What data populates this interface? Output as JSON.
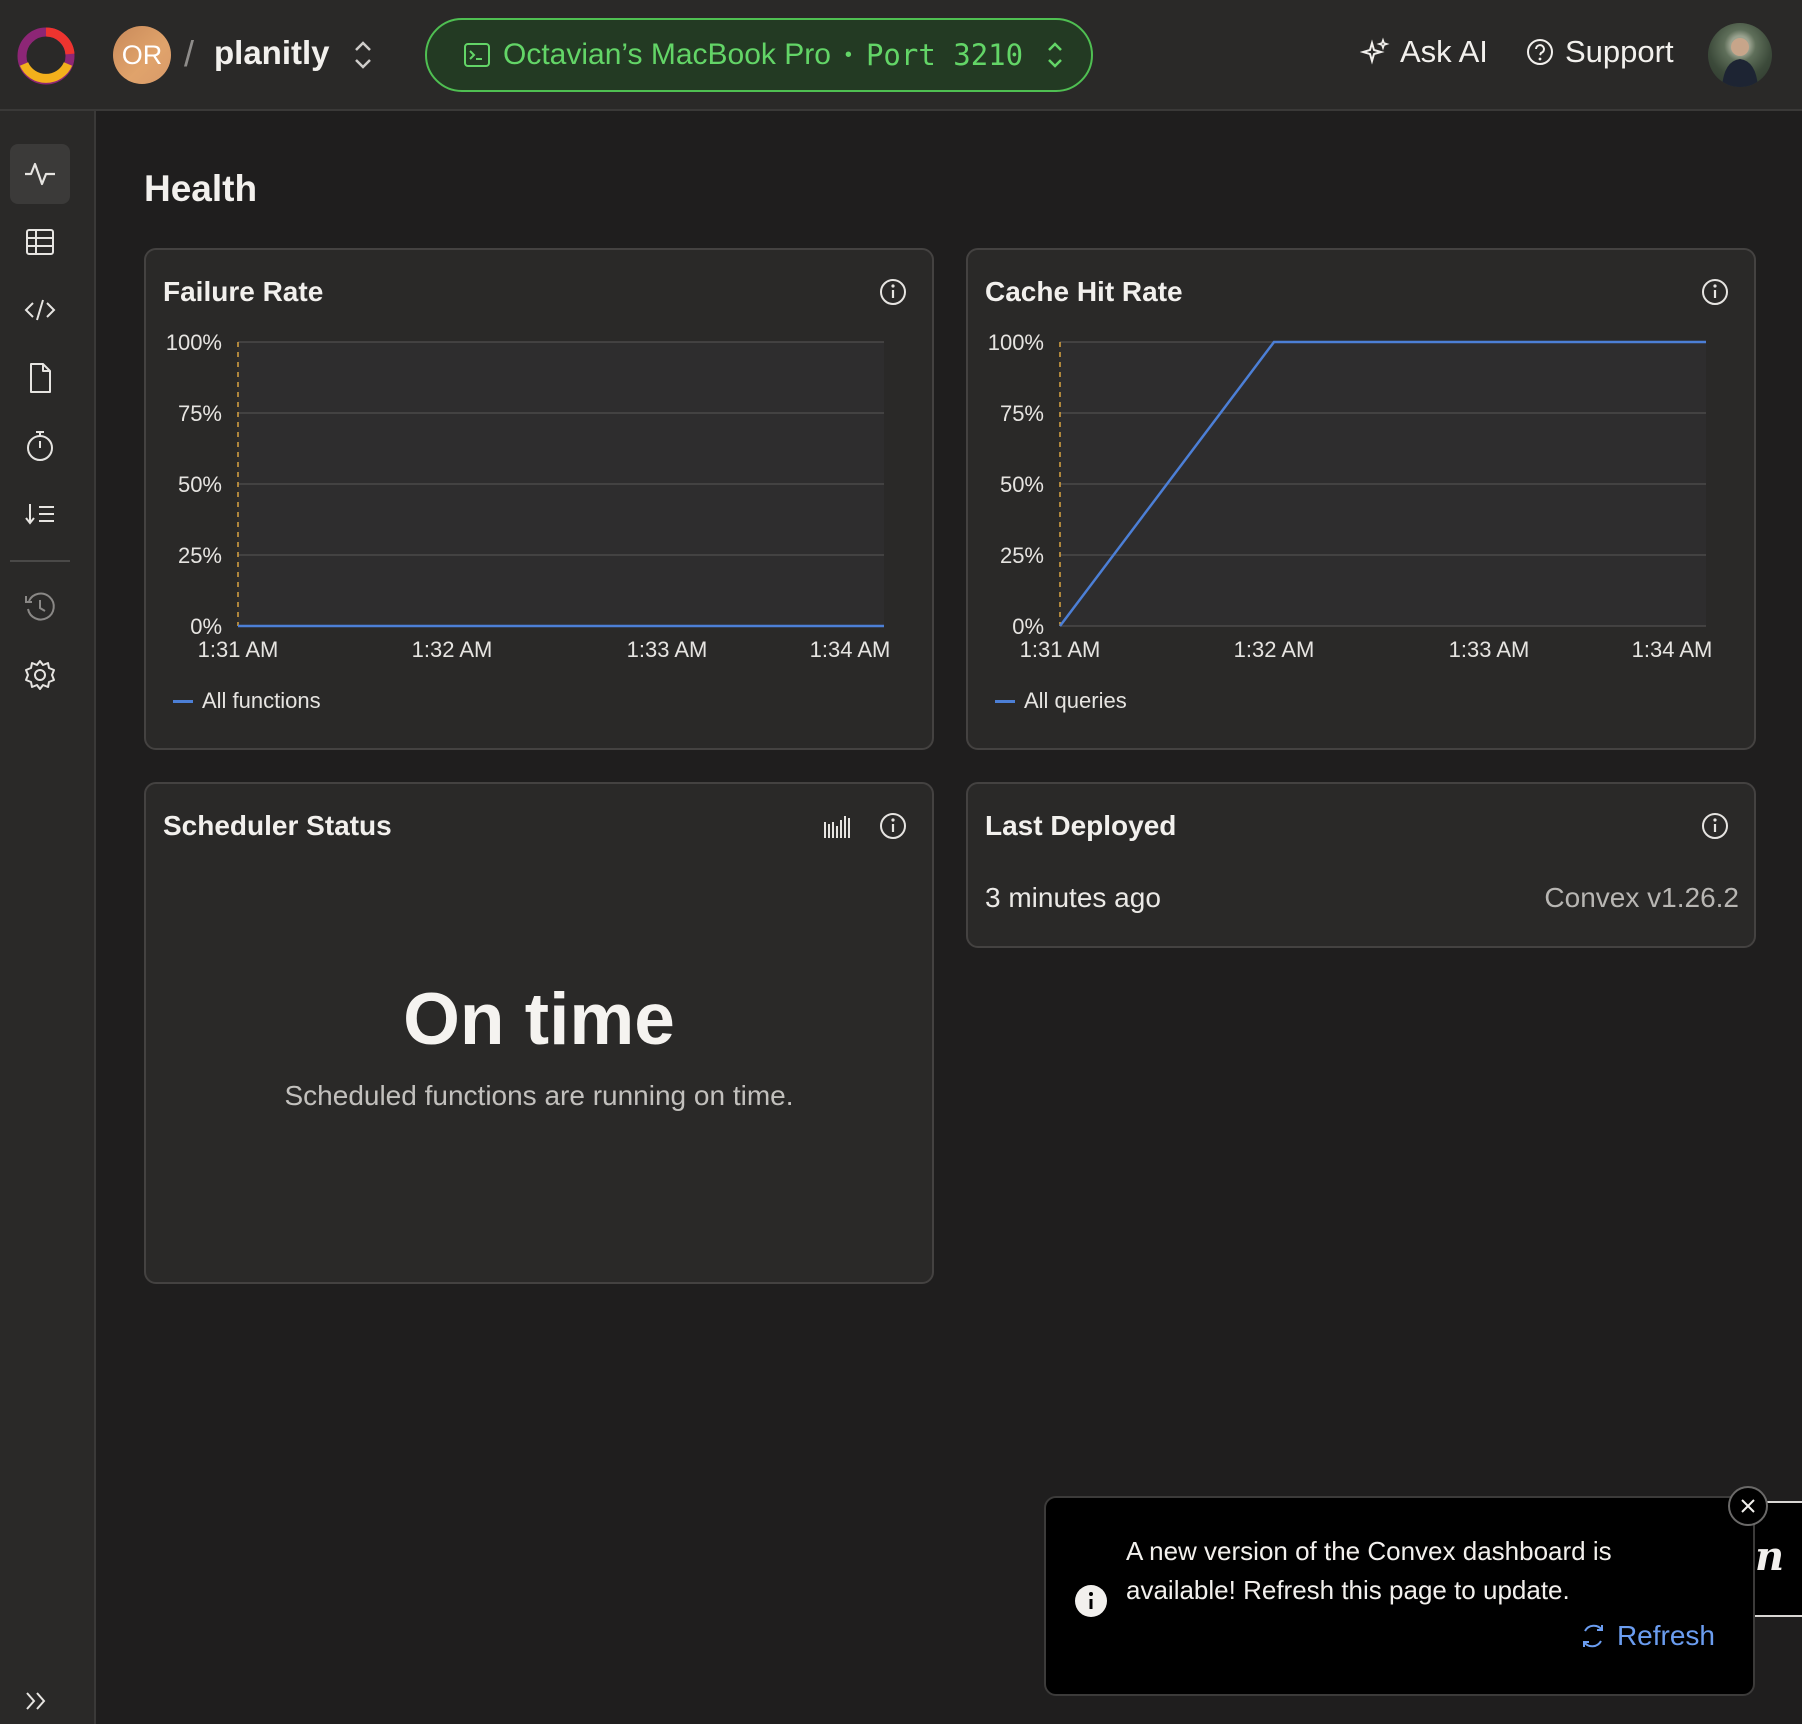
{
  "header": {
    "org_initials": "OR",
    "separator": "/",
    "project_name": "planitly",
    "deployment_name": "Octavian’s MacBook Pro",
    "deployment_dot": "•",
    "deployment_port": "Port 3210",
    "ask_ai_label": "Ask AI",
    "support_label": "Support"
  },
  "sidebar": {
    "items": [
      {
        "name": "health",
        "icon": "activity-icon"
      },
      {
        "name": "data",
        "icon": "table-icon"
      },
      {
        "name": "functions",
        "icon": "code-icon"
      },
      {
        "name": "files",
        "icon": "file-icon"
      },
      {
        "name": "schedules",
        "icon": "timer-icon"
      },
      {
        "name": "logs",
        "icon": "sort-list-icon"
      },
      {
        "name": "history",
        "icon": "history-icon"
      },
      {
        "name": "settings",
        "icon": "gear-icon"
      }
    ]
  },
  "page": {
    "title": "Health"
  },
  "cards": {
    "failure_rate": {
      "title": "Failure Rate",
      "legend": "All functions"
    },
    "cache_hit_rate": {
      "title": "Cache Hit Rate",
      "legend": "All queries"
    },
    "scheduler": {
      "title": "Scheduler Status",
      "status": "On time",
      "description": "Scheduled functions are running on time."
    },
    "last_deployed": {
      "title": "Last Deployed",
      "time": "3 minutes ago",
      "version": "Convex v1.26.2"
    }
  },
  "toast": {
    "message": "A new version of the Convex dashboard is available! Refresh this page to update.",
    "refresh_label": "Refresh"
  },
  "side_widget_text": "n",
  "colors": {
    "series": "#4c7fd6",
    "deployment_accent": "#63d567",
    "link": "#6b9df0"
  },
  "chart_data": [
    {
      "type": "line",
      "title": "Failure Rate",
      "x": [
        "1:31 AM",
        "1:32 AM",
        "1:33 AM",
        "1:34 AM"
      ],
      "series": [
        {
          "name": "All functions",
          "values": [
            0,
            0,
            0,
            0
          ]
        }
      ],
      "ytick_labels": [
        "100%",
        "75%",
        "50%",
        "25%",
        "0%"
      ],
      "ylim": [
        0,
        100
      ],
      "grid": true,
      "legend": "bottom-left"
    },
    {
      "type": "line",
      "title": "Cache Hit Rate",
      "x": [
        "1:31 AM",
        "1:32 AM",
        "1:33 AM",
        "1:34 AM"
      ],
      "series": [
        {
          "name": "All queries",
          "values": [
            0,
            100,
            100,
            100
          ]
        }
      ],
      "ytick_labels": [
        "100%",
        "75%",
        "50%",
        "25%",
        "0%"
      ],
      "ylim": [
        0,
        100
      ],
      "grid": true,
      "legend": "bottom-left"
    }
  ]
}
